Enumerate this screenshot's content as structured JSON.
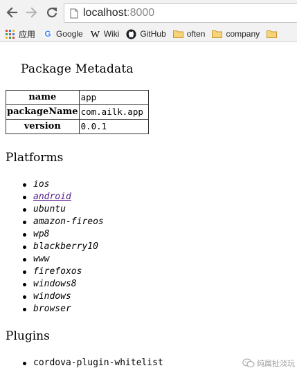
{
  "browser": {
    "url_host": "localhost",
    "url_port": ":8000",
    "bookmarks": [
      {
        "label": "应用",
        "icon": "apps-grid-icon"
      },
      {
        "label": "Google",
        "icon": "google-icon"
      },
      {
        "label": "Wiki",
        "icon": "wikipedia-icon"
      },
      {
        "label": "GitHub",
        "icon": "github-icon"
      },
      {
        "label": "often",
        "icon": "folder-icon"
      },
      {
        "label": "company",
        "icon": "folder-icon"
      }
    ]
  },
  "page": {
    "metadata_title": "Package Metadata",
    "metadata": [
      {
        "key": "name",
        "value": "app"
      },
      {
        "key": "packageName",
        "value": "com.ailk.app"
      },
      {
        "key": "version",
        "value": "0.0.1"
      }
    ],
    "platforms_heading": "Platforms",
    "platforms": [
      {
        "label": "ios",
        "link": false
      },
      {
        "label": "android",
        "link": true
      },
      {
        "label": "ubuntu",
        "link": false
      },
      {
        "label": "amazon-fireos",
        "link": false
      },
      {
        "label": "wp8",
        "link": false
      },
      {
        "label": "blackberry10",
        "link": false
      },
      {
        "label": "www",
        "link": false
      },
      {
        "label": "firefoxos",
        "link": false
      },
      {
        "label": "windows8",
        "link": false
      },
      {
        "label": "windows",
        "link": false
      },
      {
        "label": "browser",
        "link": false
      }
    ],
    "plugins_heading": "Plugins",
    "plugins": [
      {
        "label": "cordova-plugin-whitelist"
      }
    ]
  },
  "watermark": {
    "text": "纯属扯淡玩"
  },
  "colors": {
    "visited_link": "#551a8b",
    "chrome_bg": "#f2f2f2",
    "folder": "#e8b84a"
  }
}
